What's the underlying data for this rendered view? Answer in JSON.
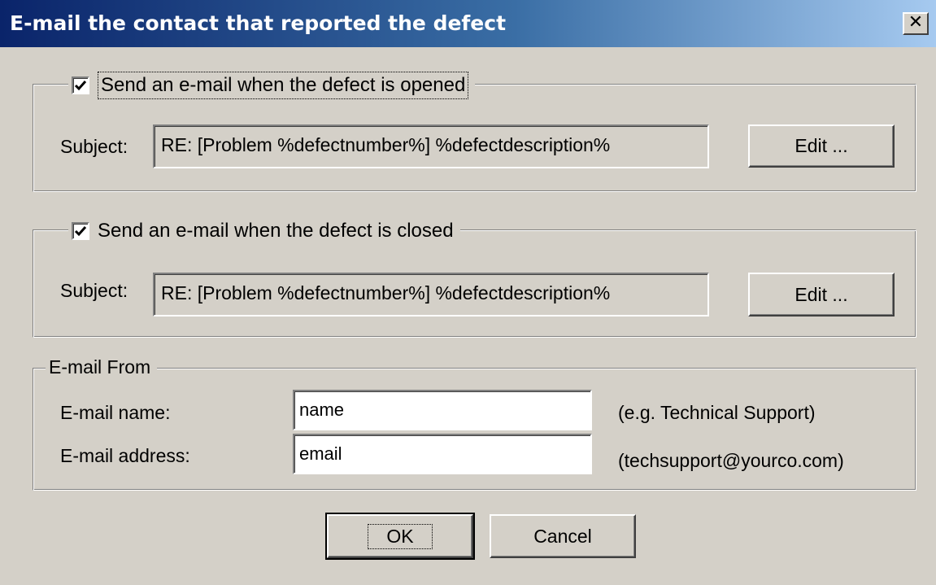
{
  "window": {
    "title": "E-mail the contact that reported the defect",
    "close_glyph": "✕"
  },
  "opened_section": {
    "checkbox_label": "Send an e-mail when the defect is opened",
    "checked": true,
    "subject_label": "Subject:",
    "subject_value": "RE: [Problem %defectnumber%] %defectdescription%",
    "edit_label": "Edit ..."
  },
  "closed_section": {
    "checkbox_label": "Send an e-mail when the defect is closed",
    "checked": true,
    "subject_label": "Subject:",
    "subject_value": "RE: [Problem %defectnumber%] %defectdescription%",
    "edit_label": "Edit ..."
  },
  "email_from": {
    "group_label": "E-mail From",
    "name_label": "E-mail name:",
    "name_value": "name",
    "name_hint": "(e.g. Technical Support)",
    "address_label": "E-mail address:",
    "address_value": "email",
    "address_hint": "(techsupport@yourco.com)"
  },
  "buttons": {
    "ok_label": "OK",
    "cancel_label": "Cancel"
  },
  "icons": {
    "close": "close-icon",
    "check": "checkmark-icon"
  }
}
